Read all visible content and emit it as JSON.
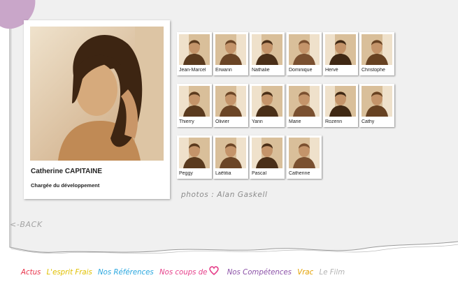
{
  "featured": {
    "name": "Catherine CAPITAINE",
    "role": "Chargée du développement"
  },
  "team": [
    {
      "label": "Jean-Marcel"
    },
    {
      "label": "Erwann"
    },
    {
      "label": "Nathalie"
    },
    {
      "label": "Dominique"
    },
    {
      "label": "Hervé"
    },
    {
      "label": "Christophe"
    },
    {
      "label": "Thierry"
    },
    {
      "label": "Olivier"
    },
    {
      "label": "Yann"
    },
    {
      "label": "Marie"
    },
    {
      "label": "Rozenn"
    },
    {
      "label": "Cathy"
    },
    {
      "label": "Peggy"
    },
    {
      "label": "Laëtitia"
    },
    {
      "label": "Pascal"
    },
    {
      "label": "Catherine"
    }
  ],
  "credit": "photos : Alan Gaskell",
  "back_label": "<-BACK",
  "nav": {
    "items": [
      {
        "label": "Actus",
        "color": "#e8334a"
      },
      {
        "label": "L'esprit Frais",
        "color": "#e0c000"
      },
      {
        "label": "Nos Références",
        "color": "#2aa7df"
      },
      {
        "label": "Nos coups de",
        "color": "#e6418b"
      },
      {
        "label": "Nos Compétences",
        "color": "#8c52a8"
      },
      {
        "label": "Vrac",
        "color": "#e3a000"
      },
      {
        "label": "Le Film",
        "color": "#b3b3b3"
      }
    ],
    "heart_color": "#e6418b"
  },
  "colors": {
    "sepia_dark": "#5a3a1e",
    "sepia_mid": "#a06a3c",
    "sepia_light": "#e2c9a8",
    "blob": "#c9a6c9"
  }
}
